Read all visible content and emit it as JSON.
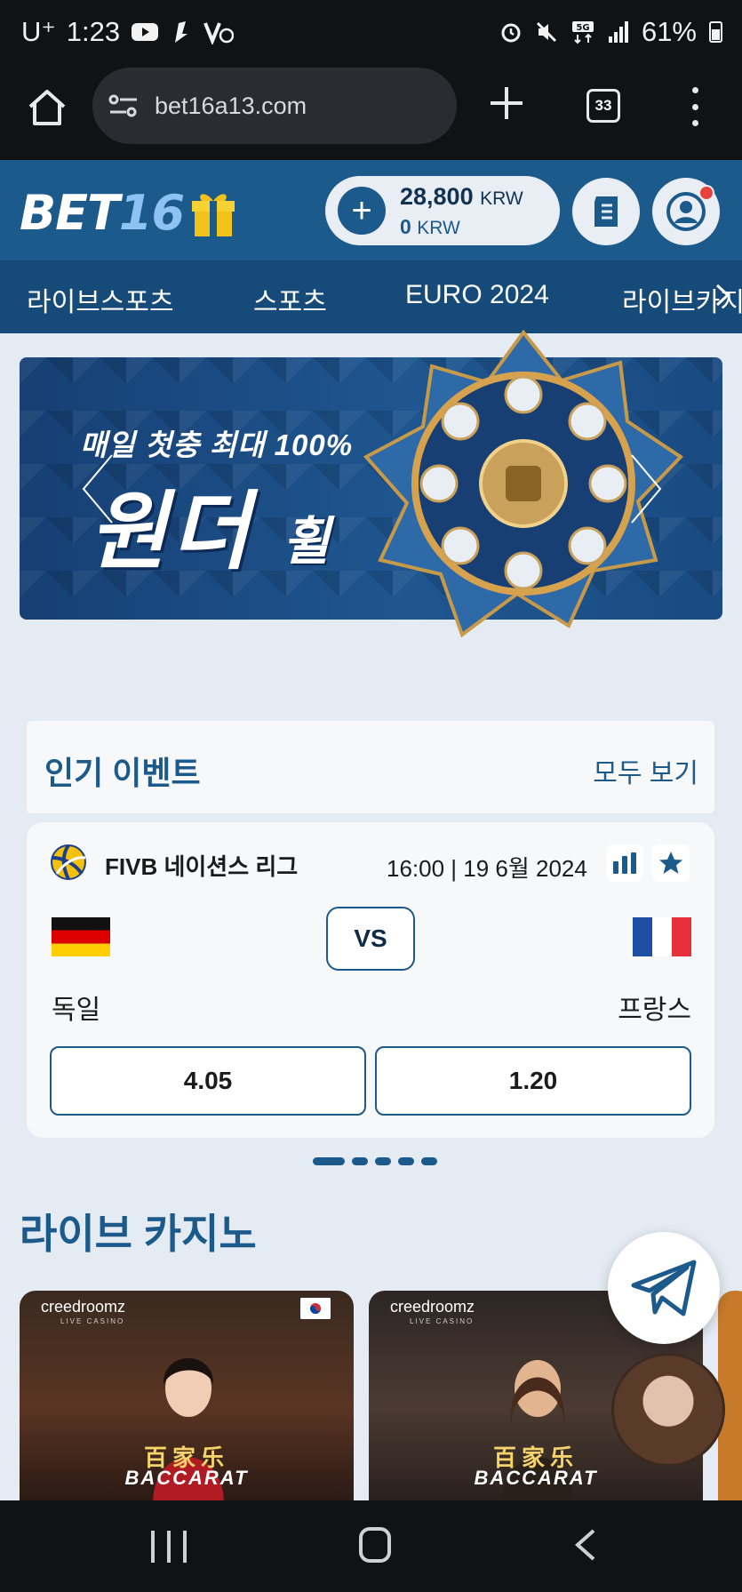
{
  "status_bar": {
    "carrier": "U⁺",
    "time": "1:23",
    "battery": "61%"
  },
  "browser": {
    "url": "bet16a13.com",
    "tab_count": "33"
  },
  "header": {
    "logo_bet": "BET",
    "logo_16": "16",
    "balance_main": "28,800",
    "balance_main_unit": "KRW",
    "balance_bonus": "0",
    "balance_bonus_unit": "KRW"
  },
  "nav": {
    "items": [
      "라이브스포츠",
      "스포츠",
      "EURO 2024",
      "라이브카지"
    ]
  },
  "banner": {
    "subtitle": "매일 첫충 최대 100%",
    "title": "원더",
    "title2": "휠"
  },
  "events": {
    "title": "인기 이벤트",
    "view_all": "모두 보기",
    "card": {
      "league": "FIVB 네이션스 리그",
      "time": "16:00 | 19 6월 2024",
      "vs": "VS",
      "home": "독일",
      "away": "프랑스",
      "odd_home": "4.05",
      "odd_away": "1.20"
    }
  },
  "casino": {
    "title": "라이브 카지노",
    "cards": [
      {
        "provider": "creedroomz",
        "provider_sub": "LIVE CASINO",
        "game_cn": "百家乐",
        "game_en": "BACCARAT"
      },
      {
        "provider": "creedroomz",
        "provider_sub": "LIVE CASINO",
        "game_cn": "百家乐",
        "game_en": "BACCARAT"
      }
    ]
  },
  "colors": {
    "brand_blue": "#1d5a8c",
    "nav_blue": "#164a78",
    "page_bg": "#e4ebf2",
    "gift_gold": "#f2c21a"
  }
}
